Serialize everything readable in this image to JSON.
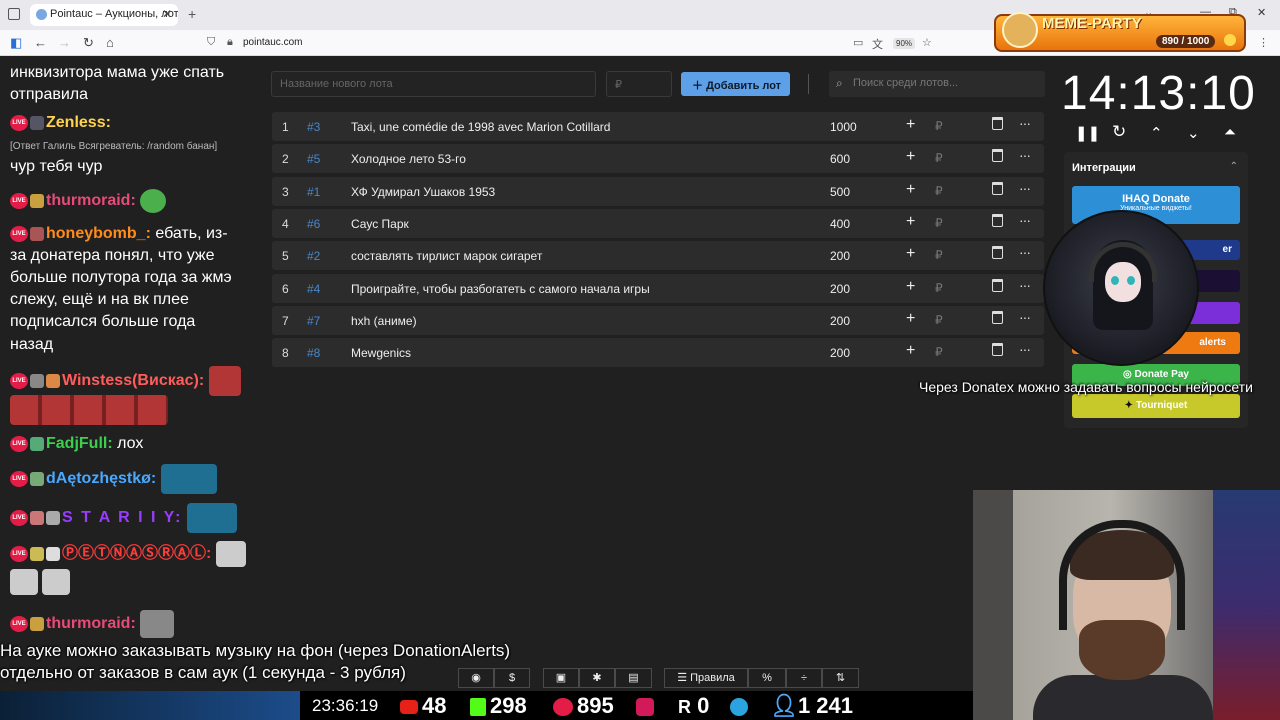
{
  "browser": {
    "tab_title": "Pointauc – Аукционы, лотереи",
    "tab_close": "✕",
    "new_tab": "+",
    "url": "pointauc.com",
    "zoom": "90%",
    "window_controls": [
      "⌄",
      "—",
      "⧉",
      "✕"
    ]
  },
  "meme_party": {
    "title": "MEME-PARTY",
    "counter": "890 / 1000"
  },
  "chat": {
    "lines": [
      {
        "text": "инквизитора мама уже спать"
      },
      {
        "text": "отправила"
      },
      {
        "nick": "Zenless:",
        "nick_color": "#ffd34e"
      },
      {
        "reply": "[Ответ Галиль Всягреватель: /random банан]"
      },
      {
        "text": "чур тебя чур"
      },
      {
        "nick": "thurmoraid:",
        "nick_color": "#e84a7a"
      },
      {
        "nick": "honeybomb_:",
        "nick_color": "#ff8c1a",
        "text": "ебать, из-"
      },
      {
        "text": "за донатера понял, что уже"
      },
      {
        "text": "больше полутора года за жмэ"
      },
      {
        "text": "слежу, ещё и на вк плее"
      },
      {
        "text": "подписался больше года"
      },
      {
        "text": "назад"
      },
      {
        "nick": "Winstess(Вискас):",
        "nick_color": "#ff5c5c"
      },
      {
        "nick": "FadjFull:",
        "nick_color": "#3ccf4e",
        "text": "лох"
      },
      {
        "nick": "dAętozhęstkø:",
        "nick_color": "#4aa8ff"
      },
      {
        "nick": "S T A R I I Y:",
        "nick_color": "#9a3cff"
      },
      {
        "nick": "ⓅⒺⓉⓃⒶⓈⓇⒶⓁ:",
        "nick_color": "#ff3c3c"
      },
      {
        "nick": "thurmoraid:",
        "nick_color": "#e84a7a"
      }
    ],
    "live_label": "LIVE"
  },
  "toolbar": {
    "new_lot_placeholder": "Название нового лота",
    "amount_placeholder": "₽",
    "add_lot": "Добавить лот",
    "search_placeholder": "Поиск среди лотов..."
  },
  "lots": [
    {
      "num": "1",
      "id": "#3",
      "name": "Taxi, une comédie de 1998 avec Marion Cotillard",
      "amount": "1000"
    },
    {
      "num": "2",
      "id": "#5",
      "name": "Холодное лето 53-го",
      "amount": "600"
    },
    {
      "num": "3",
      "id": "#1",
      "name": "ХФ Удмирал Ушаков 1953",
      "amount": "500"
    },
    {
      "num": "4",
      "id": "#6",
      "name": "Саус Парк",
      "amount": "400"
    },
    {
      "num": "5",
      "id": "#2",
      "name": "составлять тирлист марок сигарет",
      "amount": "200"
    },
    {
      "num": "6",
      "id": "#4",
      "name": "Проиграйте, чтобы разбогатеть с самого начала игры",
      "amount": "200"
    },
    {
      "num": "7",
      "id": "#7",
      "name": "hxh (аниме)",
      "amount": "200"
    },
    {
      "num": "8",
      "id": "#8",
      "name": "Mewgenics",
      "amount": "200"
    }
  ],
  "row_icons": {
    "plus": "+",
    "rub": "₽",
    "more": "···"
  },
  "timer": {
    "time": "14:13:10",
    "controls": [
      "❚❚",
      "↻",
      "⌃",
      "⌄",
      "⏶"
    ]
  },
  "integrations": {
    "title": "Интеграции",
    "buttons": [
      {
        "label": "IHAQ Donate",
        "sub": "Уникальные виджеты!",
        "color": "#2d8fd5"
      },
      {
        "label": "er",
        "color": "#1f3a8a"
      },
      {
        "label": "",
        "color": "#1b1033"
      },
      {
        "label": "",
        "color": "#7b2fd9"
      },
      {
        "label": "alerts",
        "color": "#f07a12"
      },
      {
        "label": "Donate Pay",
        "color": "#3bb54a"
      },
      {
        "label": "Tourniquet",
        "color": "#c7c92a"
      }
    ]
  },
  "overlay": {
    "donatex": "Через Donatex можно задавать вопросы нейросети",
    "music_line1": "На ауке можно заказывать музыку на фон (через DonationAlerts)",
    "music_line2": "отдельно от заказов в сам аук (1 секунда - 3 рубля)"
  },
  "bottom_buttons": {
    "rules": "Правила",
    "percent": "%",
    "dollar": "$"
  },
  "stream_stats": {
    "clock": "23:36:19",
    "youtube": "48",
    "kick": "298",
    "vk": "895",
    "rutube": "0",
    "viewers": "1 241"
  }
}
